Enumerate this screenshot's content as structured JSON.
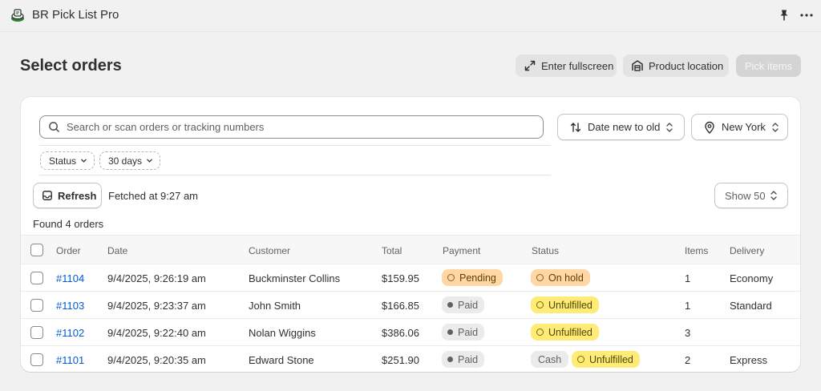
{
  "app": {
    "title": "BR Pick List Pro"
  },
  "page": {
    "title": "Select orders"
  },
  "header_buttons": {
    "fullscreen": "Enter fullscreen",
    "product_location": "Product location",
    "pick_items": "Pick items"
  },
  "search": {
    "placeholder": "Search or scan orders or tracking numbers"
  },
  "sort": {
    "value": "Date new to old"
  },
  "location": {
    "value": "New York"
  },
  "filters": {
    "status": "Status",
    "days": "30 days"
  },
  "refresh": {
    "label": "Refresh",
    "fetched": "Fetched at 9:27 am"
  },
  "show": {
    "label": "Show 50"
  },
  "found": "Found 4 orders",
  "table": {
    "headers": {
      "order": "Order",
      "date": "Date",
      "customer": "Customer",
      "total": "Total",
      "payment": "Payment",
      "status": "Status",
      "items": "Items",
      "delivery": "Delivery"
    },
    "rows": [
      {
        "order": "#1104",
        "date": "9/4/2025, 9:26:19 am",
        "customer": "Buckminster Collins",
        "total": "$159.95",
        "payment": "Pending",
        "status": "On hold",
        "items": "1",
        "delivery": "Economy"
      },
      {
        "order": "#1103",
        "date": "9/4/2025, 9:23:37 am",
        "customer": "John Smith",
        "total": "$166.85",
        "payment": "Paid",
        "status": "Unfulfilled",
        "items": "1",
        "delivery": "Standard"
      },
      {
        "order": "#1102",
        "date": "9/4/2025, 9:22:40 am",
        "customer": "Nolan Wiggins",
        "total": "$386.06",
        "payment": "Paid",
        "status": "Unfulfilled",
        "items": "3",
        "delivery": ""
      },
      {
        "order": "#1101",
        "date": "9/4/2025, 9:20:35 am",
        "customer": "Edward Stone",
        "total": "$251.90",
        "payment": "Paid",
        "tag": "Cash",
        "status": "Unfulfilled",
        "items": "2",
        "delivery": "Express"
      }
    ]
  },
  "colors": {
    "background": "#f1f1f1",
    "link": "#005bd3",
    "badge_pending": "#ffd6a4",
    "badge_unfulfilled": "#ffeb78",
    "badge_neutral": "#ebebeb",
    "logo_green": "#2e7d32"
  },
  "icons": {
    "app_logo": "app-logo-icon",
    "pin": "pin-icon",
    "more": "more-horizontal-icon",
    "fullscreen": "expand-icon",
    "location": "warehouse-icon",
    "search": "search-icon",
    "sort": "sort-arrows-icon",
    "map_pin": "map-pin-icon",
    "chevron": "chevron-down-icon",
    "refresh": "inbox-icon"
  }
}
